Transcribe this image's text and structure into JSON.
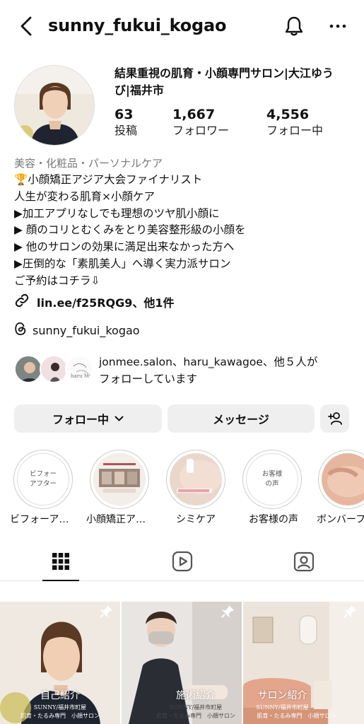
{
  "header": {
    "username": "sunny_fukui_kogao",
    "icons": {
      "back": "back-chevron-icon",
      "bell": "bell-icon",
      "more": "more-dots-icon"
    }
  },
  "profile": {
    "display_name": "結果重視の肌育・小顔専門サロン|大江ゆうび|福井市",
    "stats": [
      {
        "value": "63",
        "label": "投稿"
      },
      {
        "value": "1,667",
        "label": "フォロワー"
      },
      {
        "value": "4,556",
        "label": "フォロー中"
      }
    ],
    "category": "美容・化粧品・パーソナルケア",
    "bio_lines": [
      "🏆小顔矯正アジア大会ファイナリスト",
      "人生が変わる肌育×小顔ケア",
      "▶加工アプリなしでも理想のツヤ肌小顔に",
      "▶ 顔のコリとむくみをとり美容整形級の小顔を",
      "▶ 他のサロンの効果に満足出来なかった方へ",
      "▶圧倒的な「素肌美人」へ導く実力派サロン",
      "ご予約はコチラ⇩"
    ],
    "link": "lin.ee/f25RQG9、他1件",
    "threads_handle": "sunny_fukui_kogao",
    "mutual_text_line1": "jonmee.salon、haru_kawagoe、他５人が",
    "mutual_text_line2": "フォローしています",
    "mutual_avatar_caption": "haru My"
  },
  "buttons": {
    "following": "フォロー中",
    "message": "メッセージ"
  },
  "highlights": [
    {
      "label": "ビフォーア…",
      "cover_text_line1": "ビフォー",
      "cover_text_line2": "アフター"
    },
    {
      "label": "小顔矯正ア…",
      "cover_text_line1": "",
      "cover_text_line2": ""
    },
    {
      "label": "シミケア",
      "cover_text_line1": "",
      "cover_text_line2": ""
    },
    {
      "label": "お客様の声",
      "cover_text_line1": "お客様",
      "cover_text_line2": "の声"
    },
    {
      "label": "ボンバーフ",
      "cover_text_line1": "",
      "cover_text_line2": ""
    }
  ],
  "tabs": [
    {
      "name": "grid-icon",
      "active": true
    },
    {
      "name": "reels-icon",
      "active": false
    },
    {
      "name": "tagged-icon",
      "active": false
    }
  ],
  "posts": [
    {
      "title": "自己紹介",
      "sub1": "SUNNY/福井市町屋",
      "sub2": "肌育・たるみ専門　小顔サロン"
    },
    {
      "title": "施術紹介",
      "sub1": "SUNNY/福井市町屋",
      "sub2": "肌育・たるみ専門　小顔サロン"
    },
    {
      "title": "サロン紹介",
      "sub1": "SUNNY/福井市町屋",
      "sub2": "肌育・たるみ専門　小顔サロン"
    }
  ],
  "colors": {
    "button_bg": "#efefef",
    "muted_text": "#777777",
    "border": "#e5e5e5"
  }
}
